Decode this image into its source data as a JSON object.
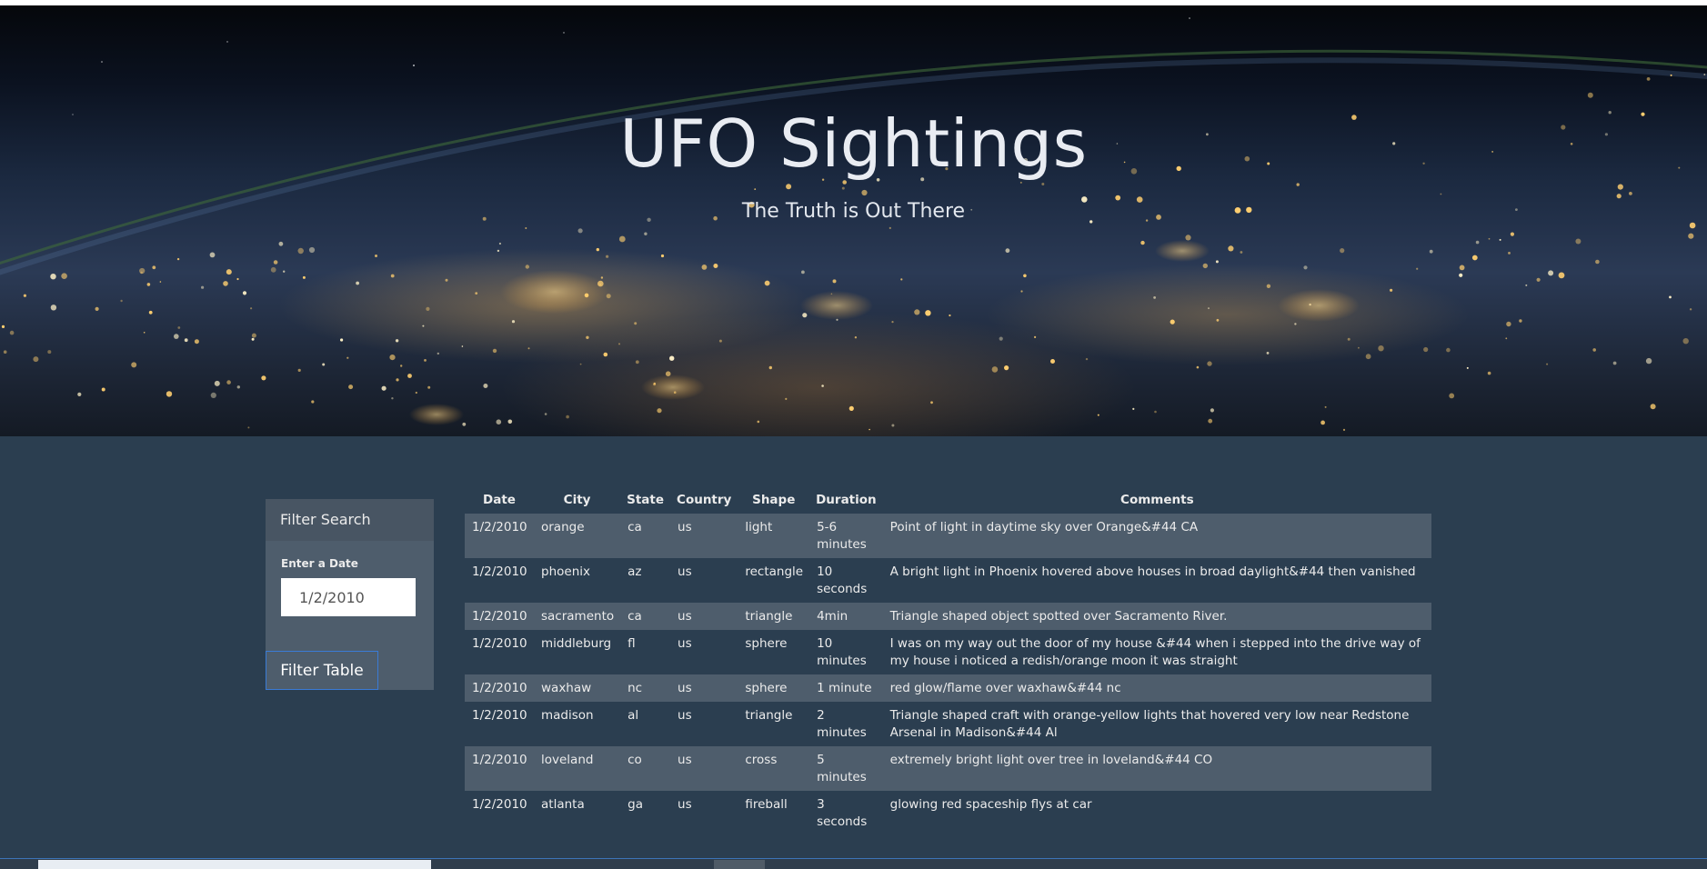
{
  "hero": {
    "title": "UFO Sightings",
    "subtitle": "The Truth is Out There"
  },
  "filter_panel": {
    "heading": "Filter Search",
    "date_label": "Enter a Date",
    "date_value": "1/2/2010",
    "button_label": "Filter Table"
  },
  "table": {
    "headers": [
      "Date",
      "City",
      "State",
      "Country",
      "Shape",
      "Duration",
      "Comments"
    ],
    "rows": [
      [
        "1/2/2010",
        "orange",
        "ca",
        "us",
        "light",
        "5-6 minutes",
        "Point of light in daytime sky over Orange&#44 CA"
      ],
      [
        "1/2/2010",
        "phoenix",
        "az",
        "us",
        "rectangle",
        "10 seconds",
        "A bright light in Phoenix hovered above houses in broad daylight&#44 then vanished"
      ],
      [
        "1/2/2010",
        "sacramento",
        "ca",
        "us",
        "triangle",
        "4min",
        "Triangle shaped object spotted over Sacramento River."
      ],
      [
        "1/2/2010",
        "middleburg",
        "fl",
        "us",
        "sphere",
        "10 minutes",
        "I was on my way out the door of my house &#44 when i stepped into the drive way of my house i noticed a redish/orange moon it was straight"
      ],
      [
        "1/2/2010",
        "waxhaw",
        "nc",
        "us",
        "sphere",
        "1 minute",
        "red glow/flame over waxhaw&#44 nc"
      ],
      [
        "1/2/2010",
        "madison",
        "al",
        "us",
        "triangle",
        "2 minutes",
        "Triangle shaped craft with orange-yellow lights that hovered very low near Redstone Arsenal in Madison&#44 Al"
      ],
      [
        "1/2/2010",
        "loveland",
        "co",
        "us",
        "cross",
        "5 minutes",
        "extremely bright light over tree in loveland&#44 CO"
      ],
      [
        "1/2/2010",
        "atlanta",
        "ga",
        "us",
        "fireball",
        "3 seconds",
        "glowing red spaceship flys at car"
      ]
    ]
  },
  "colors": {
    "page_bg": "#2b3e50",
    "panel_bg": "#4e5d6c",
    "stripe_bg": "#4e5d6c",
    "button_border": "#3a7bd5"
  }
}
